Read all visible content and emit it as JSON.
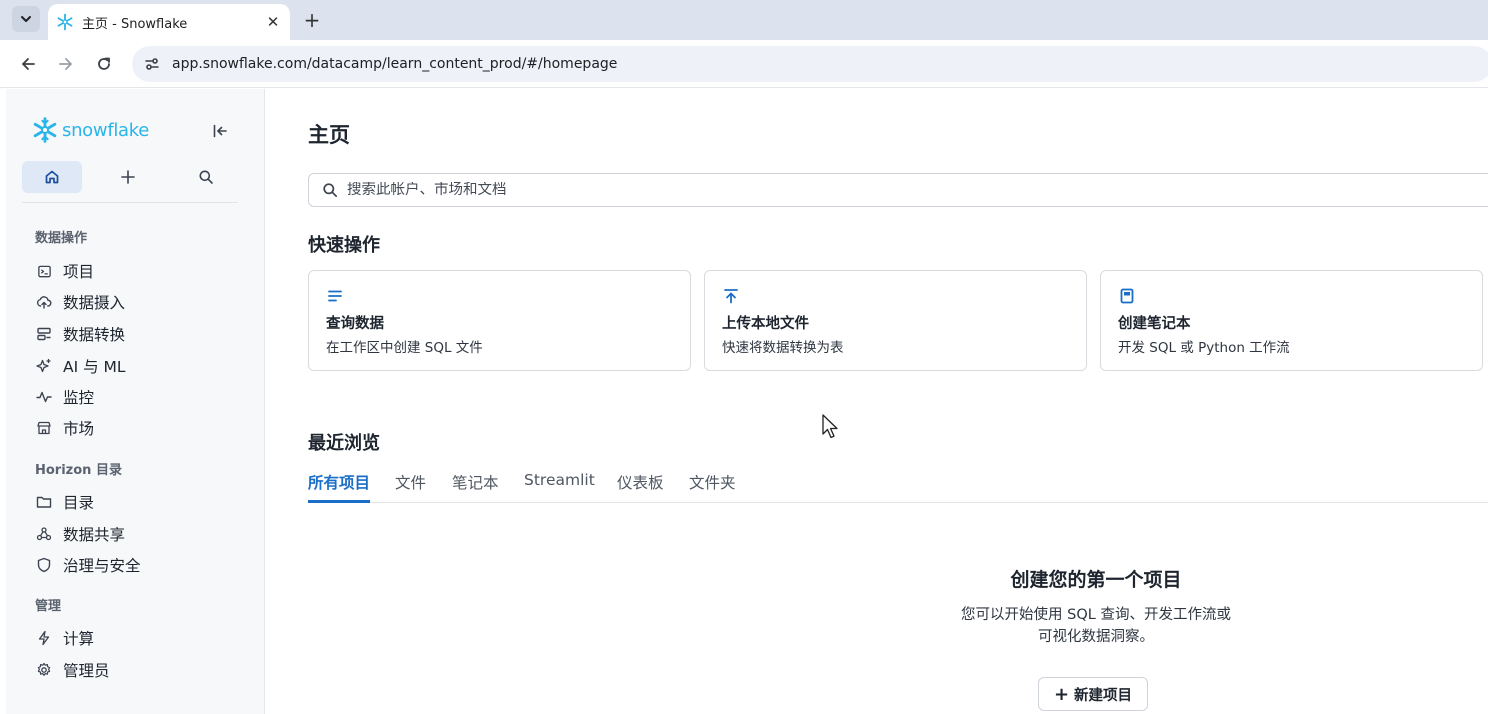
{
  "browser": {
    "tab_title": "主页 - Snowflake",
    "url": "app.snowflake.com/datacamp/learn_content_prod/#/homepage",
    "new_tab_symbol": "+",
    "close_symbol": "✕"
  },
  "sidebar": {
    "brand": "snowflake",
    "sections": [
      {
        "label": "数据操作",
        "items": [
          {
            "label": "项目",
            "icon": "terminal-icon"
          },
          {
            "label": "数据摄入",
            "icon": "cloud-upload-icon"
          },
          {
            "label": "数据转换",
            "icon": "transform-icon"
          },
          {
            "label": "AI 与 ML",
            "icon": "sparkle-icon"
          },
          {
            "label": "监控",
            "icon": "activity-icon"
          },
          {
            "label": "市场",
            "icon": "store-icon"
          }
        ]
      },
      {
        "label": "Horizon 目录",
        "items": [
          {
            "label": "目录",
            "icon": "folder-icon"
          },
          {
            "label": "数据共享",
            "icon": "share-icon"
          },
          {
            "label": "治理与安全",
            "icon": "shield-icon"
          }
        ]
      },
      {
        "label": "管理",
        "items": [
          {
            "label": "计算",
            "icon": "bolt-icon"
          },
          {
            "label": "管理员",
            "icon": "gear-icon"
          }
        ]
      }
    ]
  },
  "main": {
    "title": "主页",
    "search_placeholder": "搜索此帐户、市场和文档",
    "quick_actions_title": "快速操作",
    "quick_actions": [
      {
        "title": "查询数据",
        "desc": "在工作区中创建 SQL 文件",
        "icon": "lines-icon"
      },
      {
        "title": "上传本地文件",
        "desc": "快速将数据转换为表",
        "icon": "upload-icon"
      },
      {
        "title": "创建笔记本",
        "desc": "开发 SQL 或 Python 工作流",
        "icon": "notebook-icon"
      }
    ],
    "recent_title": "最近浏览",
    "recent_tabs": [
      "所有项目",
      "文件",
      "笔记本",
      "Streamlit",
      "仪表板",
      "文件夹"
    ],
    "active_tab_index": 0,
    "empty_title": "创建您的第一个项目",
    "empty_desc_line1": "您可以开始使用 SQL 查询、开发工作流或",
    "empty_desc_line2": "可视化数据洞察。",
    "new_button": "新建项目"
  },
  "colors": {
    "accent": "#1a6ec7",
    "brand": "#29b5e8",
    "sidebar_bg": "#f7f8fa"
  }
}
